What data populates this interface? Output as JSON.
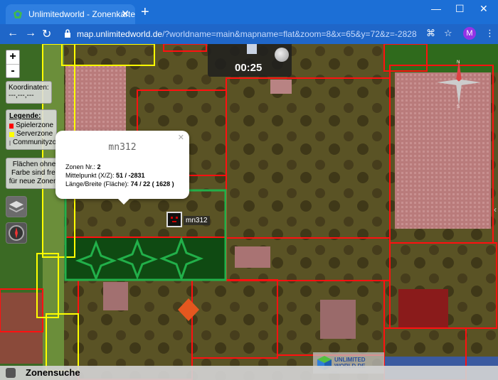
{
  "browser": {
    "tab_title": "Unlimitedworld - Zonenkarte",
    "new_tab": "+",
    "url_host": "map.unlimitedworld.de",
    "url_rest": "/?worldname=main&mapname=flat&zoom=8&x=65&y=72&z=-2828",
    "avatar_initial": "M"
  },
  "map": {
    "zoom_in": "+",
    "zoom_out": "-",
    "coords_label": "Koordinaten:",
    "coords_value": "---,---,---",
    "legend_title": "Legende:",
    "legend": [
      {
        "label": "Spielerzone",
        "color": "#ff0000"
      },
      {
        "label": "Serverzone",
        "color": "#ffff00"
      },
      {
        "label": "Communityzone",
        "color": "#ffffff"
      }
    ],
    "free_hint": "Flächen ohne Farbe sind frei für neue Zonen.",
    "time": "00:25",
    "popup": {
      "name": "mn312",
      "zone_nr_label": "Zonen Nr.:",
      "zone_nr": "2",
      "center_label": "Mittelpunkt (X/Z):",
      "center": "51 / -2831",
      "size_label": "Länge/Breite (Fläche):",
      "size": "74 / 22 ( 1628 )"
    },
    "player_name": "mn312",
    "compass": {
      "n": "N",
      "s": "S"
    },
    "logo_line1": "UNLIMITED",
    "logo_line2": "WORLD.DE",
    "search_label": "Zonensuche"
  }
}
